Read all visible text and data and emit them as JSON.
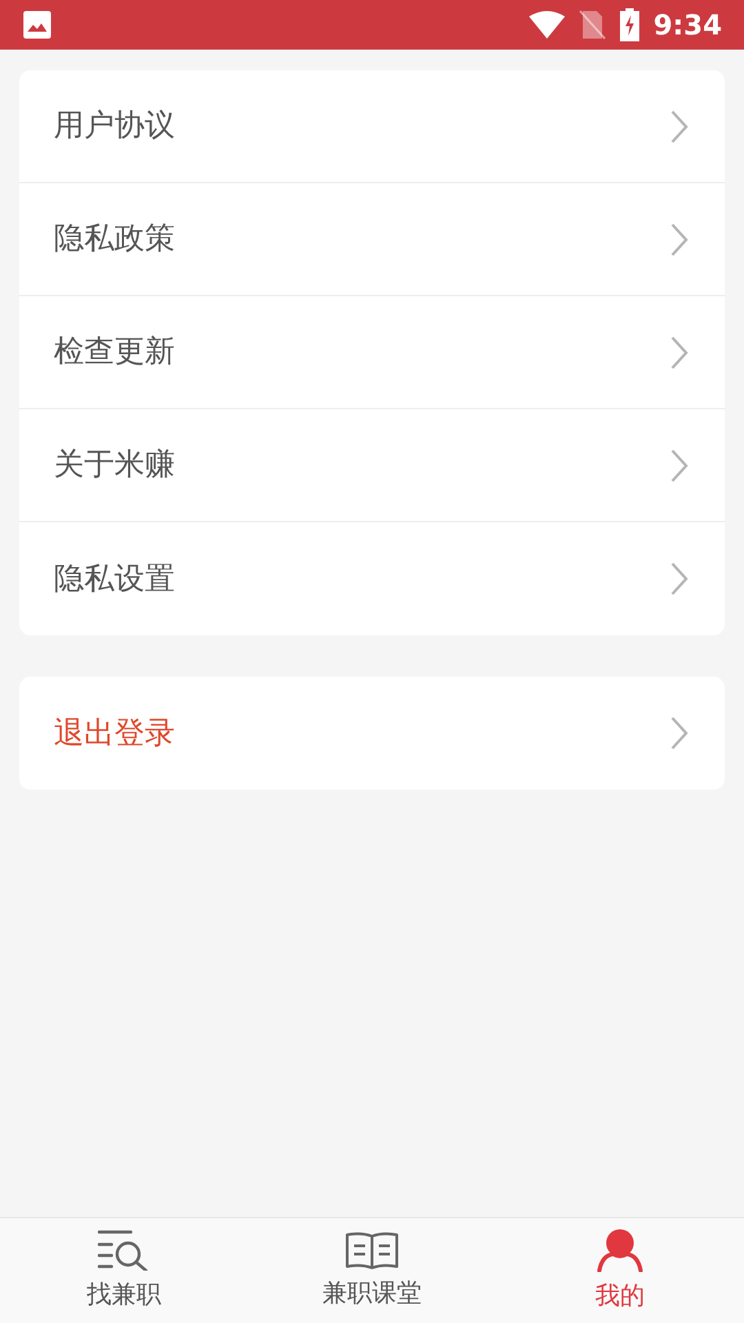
{
  "status_bar": {
    "time": "9:34"
  },
  "menu": [
    {
      "label": "用户协议"
    },
    {
      "label": "隐私政策"
    },
    {
      "label": "检查更新"
    },
    {
      "label": "关于米赚"
    },
    {
      "label": "隐私设置"
    }
  ],
  "logout": {
    "label": "退出登录",
    "kind": "danger"
  },
  "tabs": [
    {
      "label": "找兼职",
      "kind": "search",
      "selected": false
    },
    {
      "label": "兼职课堂",
      "kind": "book",
      "selected": false
    },
    {
      "label": "我的",
      "kind": "person",
      "selected": true
    }
  ]
}
